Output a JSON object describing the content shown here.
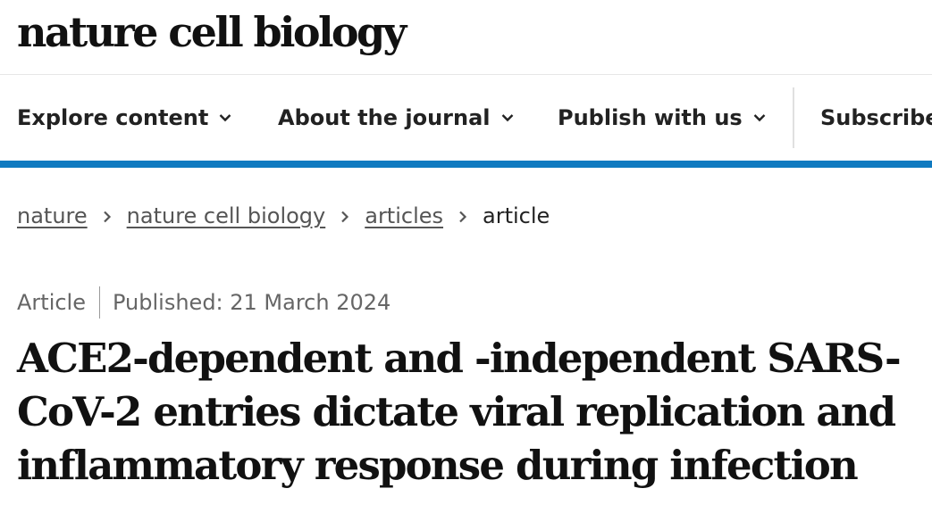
{
  "masthead": {
    "logo_text": "nature cell biology"
  },
  "nav": {
    "items": [
      {
        "label": "Explore content",
        "has_dropdown": true
      },
      {
        "label": "About the journal",
        "has_dropdown": true
      },
      {
        "label": "Publish with us",
        "has_dropdown": true
      },
      {
        "label": "Subscribe",
        "has_dropdown": false
      }
    ],
    "accent_color": "#0f7ac0"
  },
  "breadcrumb": {
    "items": [
      "nature",
      "nature cell biology",
      "articles",
      "article"
    ]
  },
  "article": {
    "type": "Article",
    "published": "Published: 21 March 2024",
    "title_lines": [
      "ACE2-dependent and -independent SARS-",
      "CoV-2 entries dictate viral replication and",
      "inflammatory response during infection"
    ]
  }
}
